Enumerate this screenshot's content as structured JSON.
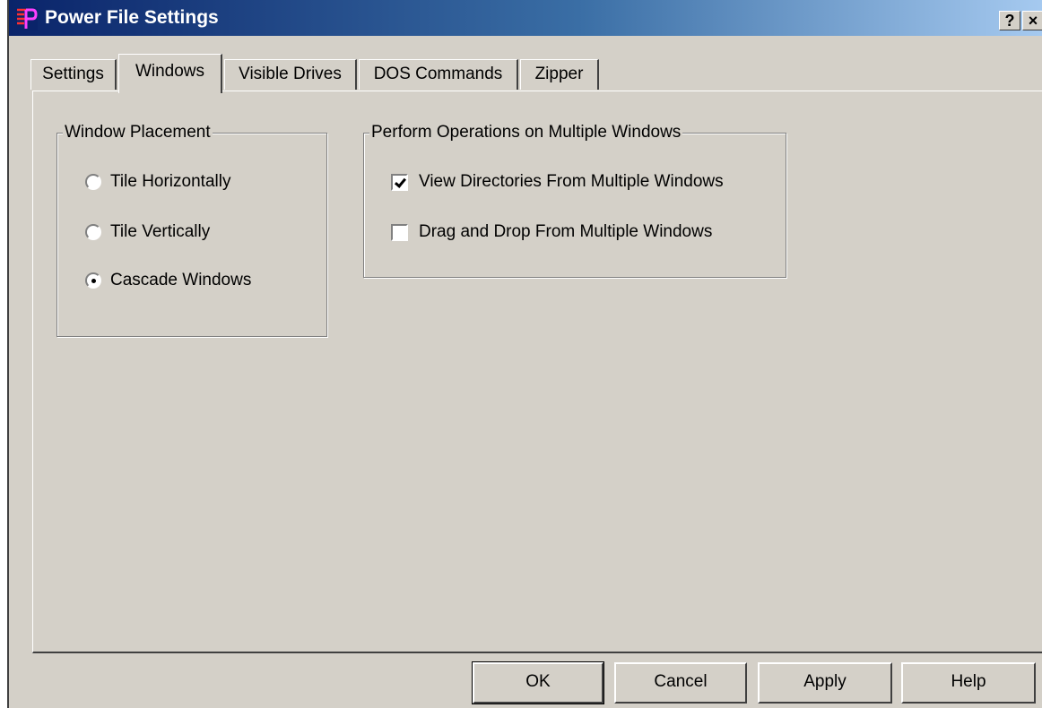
{
  "window": {
    "title": "Power File Settings",
    "help_label": "?",
    "close_label": "×"
  },
  "tabs": [
    {
      "label": "Settings",
      "active": false
    },
    {
      "label": "Windows",
      "active": true
    },
    {
      "label": "Visible Drives",
      "active": false
    },
    {
      "label": "DOS Commands",
      "active": false
    },
    {
      "label": "Zipper",
      "active": false
    }
  ],
  "window_placement": {
    "legend": "Window Placement",
    "options": [
      {
        "label": "Tile Horizontally",
        "checked": false
      },
      {
        "label": "Tile Vertically",
        "checked": false
      },
      {
        "label": "Cascade Windows",
        "checked": true
      }
    ]
  },
  "multiple_windows": {
    "legend": "Perform Operations on Multiple Windows",
    "options": [
      {
        "label": "View Directories From Multiple Windows",
        "checked": true
      },
      {
        "label": "Drag and Drop From Multiple Windows",
        "checked": false
      }
    ]
  },
  "buttons": {
    "ok": "OK",
    "cancel": "Cancel",
    "apply": "Apply",
    "help": "Help"
  },
  "colors": {
    "title_gradient_start": "#0a246a",
    "title_gradient_end": "#a6caf0",
    "face": "#d4d0c8"
  }
}
